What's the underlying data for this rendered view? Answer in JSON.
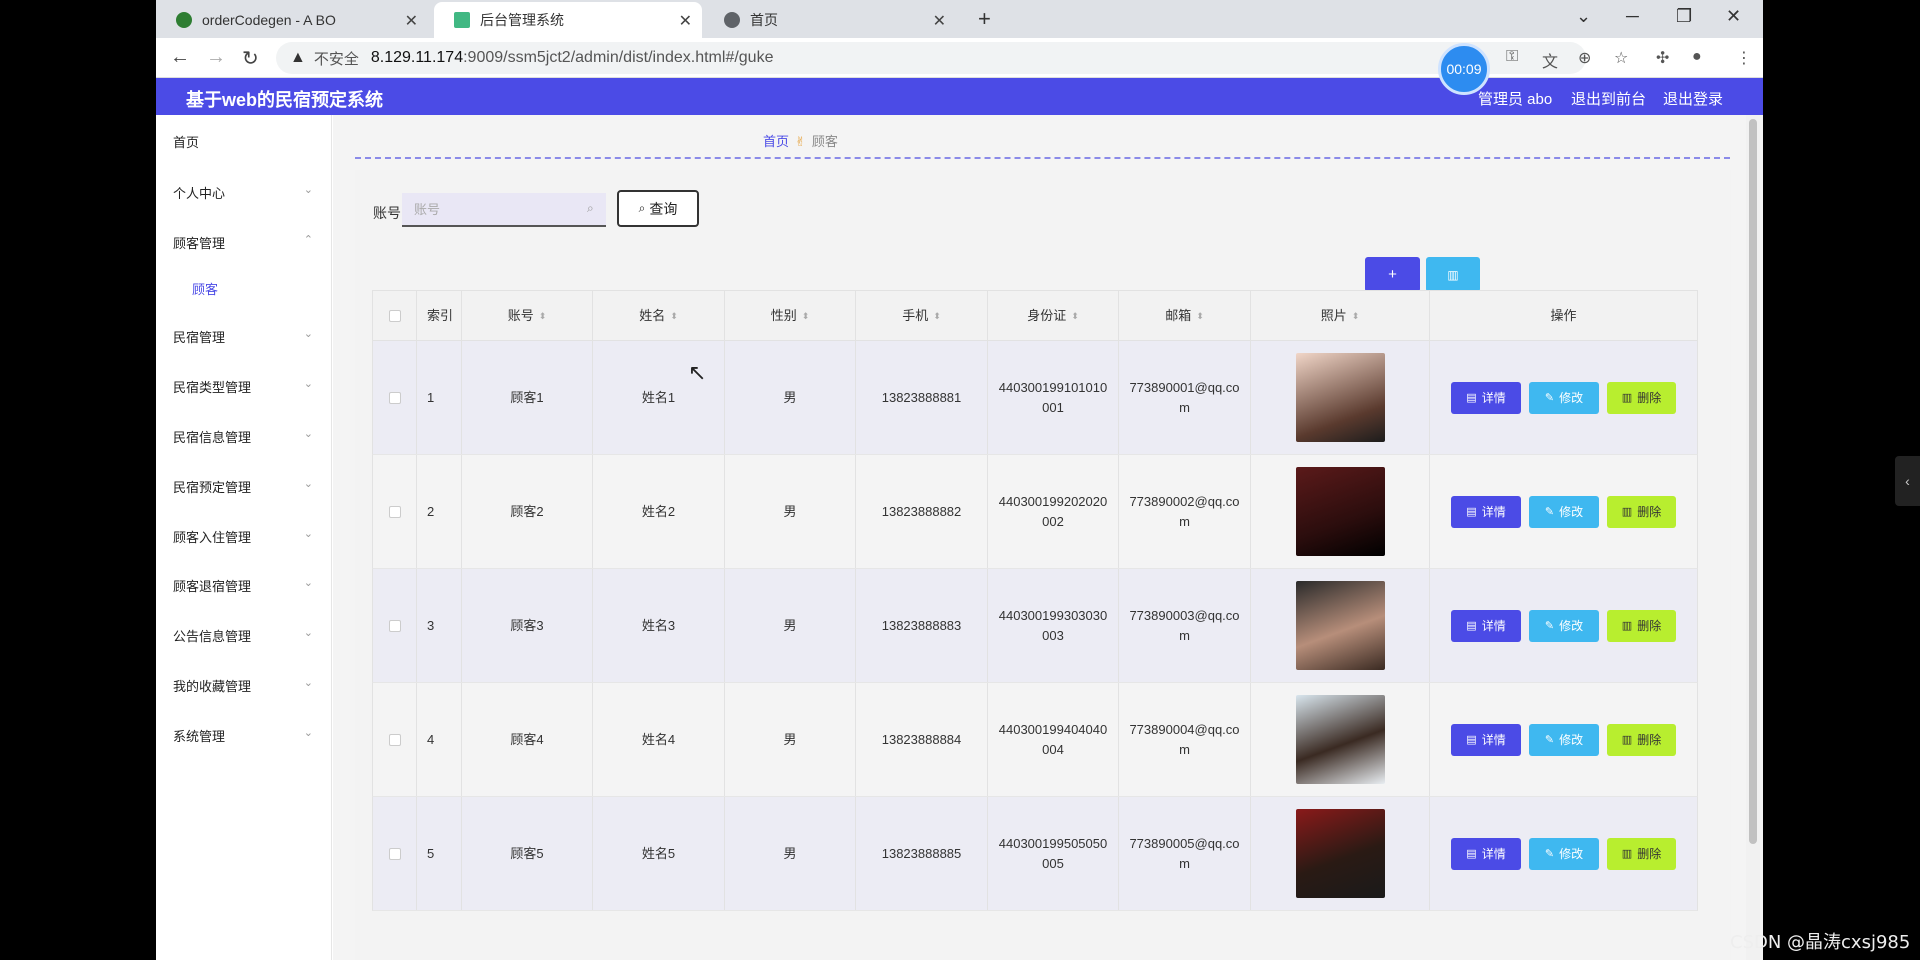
{
  "browser": {
    "tabs": [
      {
        "title": "orderCodegen - A BO",
        "close": "✕"
      },
      {
        "title": "后台管理系统",
        "close": "✕"
      },
      {
        "title": "首页",
        "close": "✕"
      }
    ],
    "new_tab": "+",
    "window_controls": [
      "⌄",
      "─",
      "❐",
      "✕"
    ],
    "nav": {
      "back": "←",
      "forward": "→",
      "reload": "↻"
    },
    "address": {
      "warning": "▲",
      "insecure_label": "不安全",
      "host": "8.129.11.174",
      "path": ":9009/ssm5jct2/admin/dist/index.html#/guke"
    },
    "toolbar_icons": [
      "key-icon",
      "translate-icon",
      "zoom-icon",
      "star-icon",
      "extensions-icon",
      "profile-icon",
      "menu-icon"
    ],
    "recording_timer": "00:09"
  },
  "app": {
    "title": "基于web的民宿预定系统",
    "header_links": {
      "admin": "管理员 abo",
      "frontend": "退出到前台",
      "logout": "退出登录"
    },
    "sidebar": {
      "items": [
        {
          "label": "首页",
          "chevron": ""
        },
        {
          "label": "个人中心",
          "chevron": "⌄"
        },
        {
          "label": "顾客管理",
          "chevron": "⌃"
        },
        {
          "label": "民宿管理",
          "chevron": "⌄"
        },
        {
          "label": "民宿类型管理",
          "chevron": "⌄"
        },
        {
          "label": "民宿信息管理",
          "chevron": "⌄"
        },
        {
          "label": "民宿预定管理",
          "chevron": "⌄"
        },
        {
          "label": "顾客入住管理",
          "chevron": "⌄"
        },
        {
          "label": "顾客退宿管理",
          "chevron": "⌄"
        },
        {
          "label": "公告信息管理",
          "chevron": "⌄"
        },
        {
          "label": "我的收藏管理",
          "chevron": "⌄"
        },
        {
          "label": "系统管理",
          "chevron": "⌄"
        }
      ],
      "sub_item": "顾客"
    },
    "breadcrumb": {
      "home": "首页",
      "separator": "✌",
      "current": "顾客"
    },
    "search": {
      "label": "账号",
      "placeholder": "账号",
      "button": "查询",
      "button_icon": "🔍"
    },
    "actions": {
      "add": "+",
      "delete": "🗑"
    },
    "table": {
      "headers": [
        "索引",
        "账号",
        "姓名",
        "性别",
        "手机",
        "身份证",
        "邮箱",
        "照片",
        "操作"
      ],
      "sort_icon": "⬍",
      "ops": {
        "detail": "详情",
        "edit": "修改",
        "delete": "删除"
      },
      "rows": [
        {
          "index": "1",
          "account": "顾客1",
          "name": "姓名1",
          "sex": "男",
          "phone": "13823888881",
          "id_card": "440300199101010001",
          "email": "773890001@qq.com"
        },
        {
          "index": "2",
          "account": "顾客2",
          "name": "姓名2",
          "sex": "男",
          "phone": "13823888882",
          "id_card": "440300199202020002",
          "email": "773890002@qq.com"
        },
        {
          "index": "3",
          "account": "顾客3",
          "name": "姓名3",
          "sex": "男",
          "phone": "13823888883",
          "id_card": "440300199303030003",
          "email": "773890003@qq.com"
        },
        {
          "index": "4",
          "account": "顾客4",
          "name": "姓名4",
          "sex": "男",
          "phone": "13823888884",
          "id_card": "440300199404040004",
          "email": "773890004@qq.com"
        },
        {
          "index": "5",
          "account": "顾客5",
          "name": "姓名5",
          "sex": "男",
          "phone": "13823888885",
          "id_card": "440300199505050005",
          "email": "773890005@qq.com"
        }
      ]
    }
  },
  "overlay": {
    "side_tab": "‹",
    "watermark": "CSDN @晶涛cxsj985"
  },
  "colors": {
    "accent": "#4b4be6",
    "edit": "#3fb8f0",
    "delete": "#b8ee2f"
  }
}
